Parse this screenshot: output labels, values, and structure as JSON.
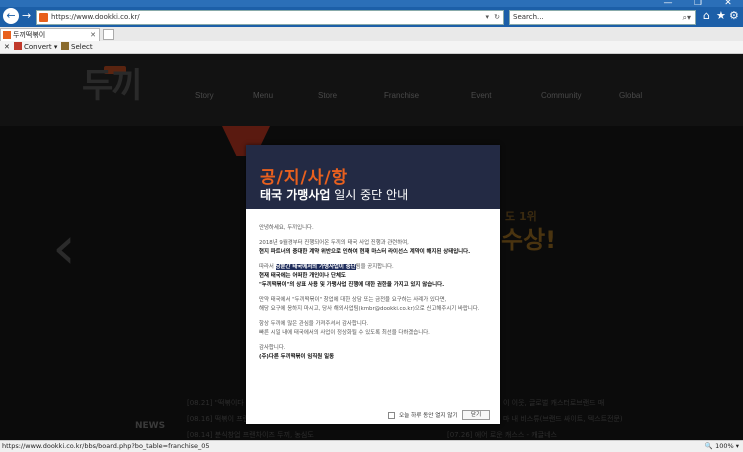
{
  "browser": {
    "window_controls": [
      "—",
      "❐",
      "✕"
    ],
    "url": "https://www.dookki.co.kr/",
    "search_placeholder": "Search...",
    "tab_title": "두끼떡볶이",
    "toolbar": {
      "convert_label": "Convert",
      "select_label": "Select"
    },
    "status_url": "https://www.dookki.co.kr/bbs/board.php?bo_table=franchise_05",
    "zoom": "100%"
  },
  "site": {
    "logo_text": "두끼",
    "nav": [
      "Story",
      "Menu",
      "Store",
      "Franchise",
      "Event",
      "Community",
      "Global"
    ],
    "hero_text_small": "도 1위",
    "hero_text_big": "수상!",
    "news_label": "NEWS",
    "news_left": [
      "[08.21] \"떡볶이다",
      "[08.16] 떡볶이 프랜",
      "[08.14] 분식창업 프랜차이즈 두끼, 농심도"
    ],
    "news_right": [
      "이 이웃, 글로벌 캐스터로브랜드 매",
      "마 내 비스튜(브랜드 싸이트, 텍스트전문)",
      "[07.26] 에어 로운 캐스스 - 캐글네스"
    ]
  },
  "modal": {
    "title": "공/지/사/항",
    "subtitle_bold": "태국 가맹사업",
    "subtitle_rest": " 일시 중단 안내",
    "greeting": "안녕하세요, 두끼입니다.",
    "line2": "2018년 9월경부터 진행되어온 두끼의 태국 사업 진행과 관련하여,",
    "line3": "현지 파트너의 중대한 계약 위반으로 인하여 현재 마스터 라이선스 계약이 해지된 상태입니다.",
    "line4_prefix": "따라서 ",
    "line4_highlight": "당분간 태국에서의 가맹사업이 중단",
    "line4_suffix": "됨을 공지합니다.",
    "line5": "현재 태국에는 어떠한 개인이나 단체도",
    "line6": "\"두끼떡볶이\"의 상표 사용 및 가맹사업 진행에 대한 권한을 가지고 있지 않습니다.",
    "line7": "만약 태국에서 \"두끼떡볶이\" 창업에 대한 상담 또는 금전을 요구하는 사례가 있다면,",
    "line8": "해당 요구에 응하지 마시고, 당사 해외사업팀(kmbr@dookki.co.kr)으로 신고해주시기 바랍니다.",
    "line9": "항상 두끼에 많은 관심을 가져주셔서 감사합니다.",
    "line10": "빠른 시일 내에 태국에서의 사업이 정상화될 수 있도록 최선을 다하겠습니다.",
    "line11": "감사합니다.",
    "line12": "(주)다른 두끼떡볶이 임직원 일동",
    "checkbox_label": "오늘 하루 동안 열지 않기",
    "close_label": "닫기"
  }
}
